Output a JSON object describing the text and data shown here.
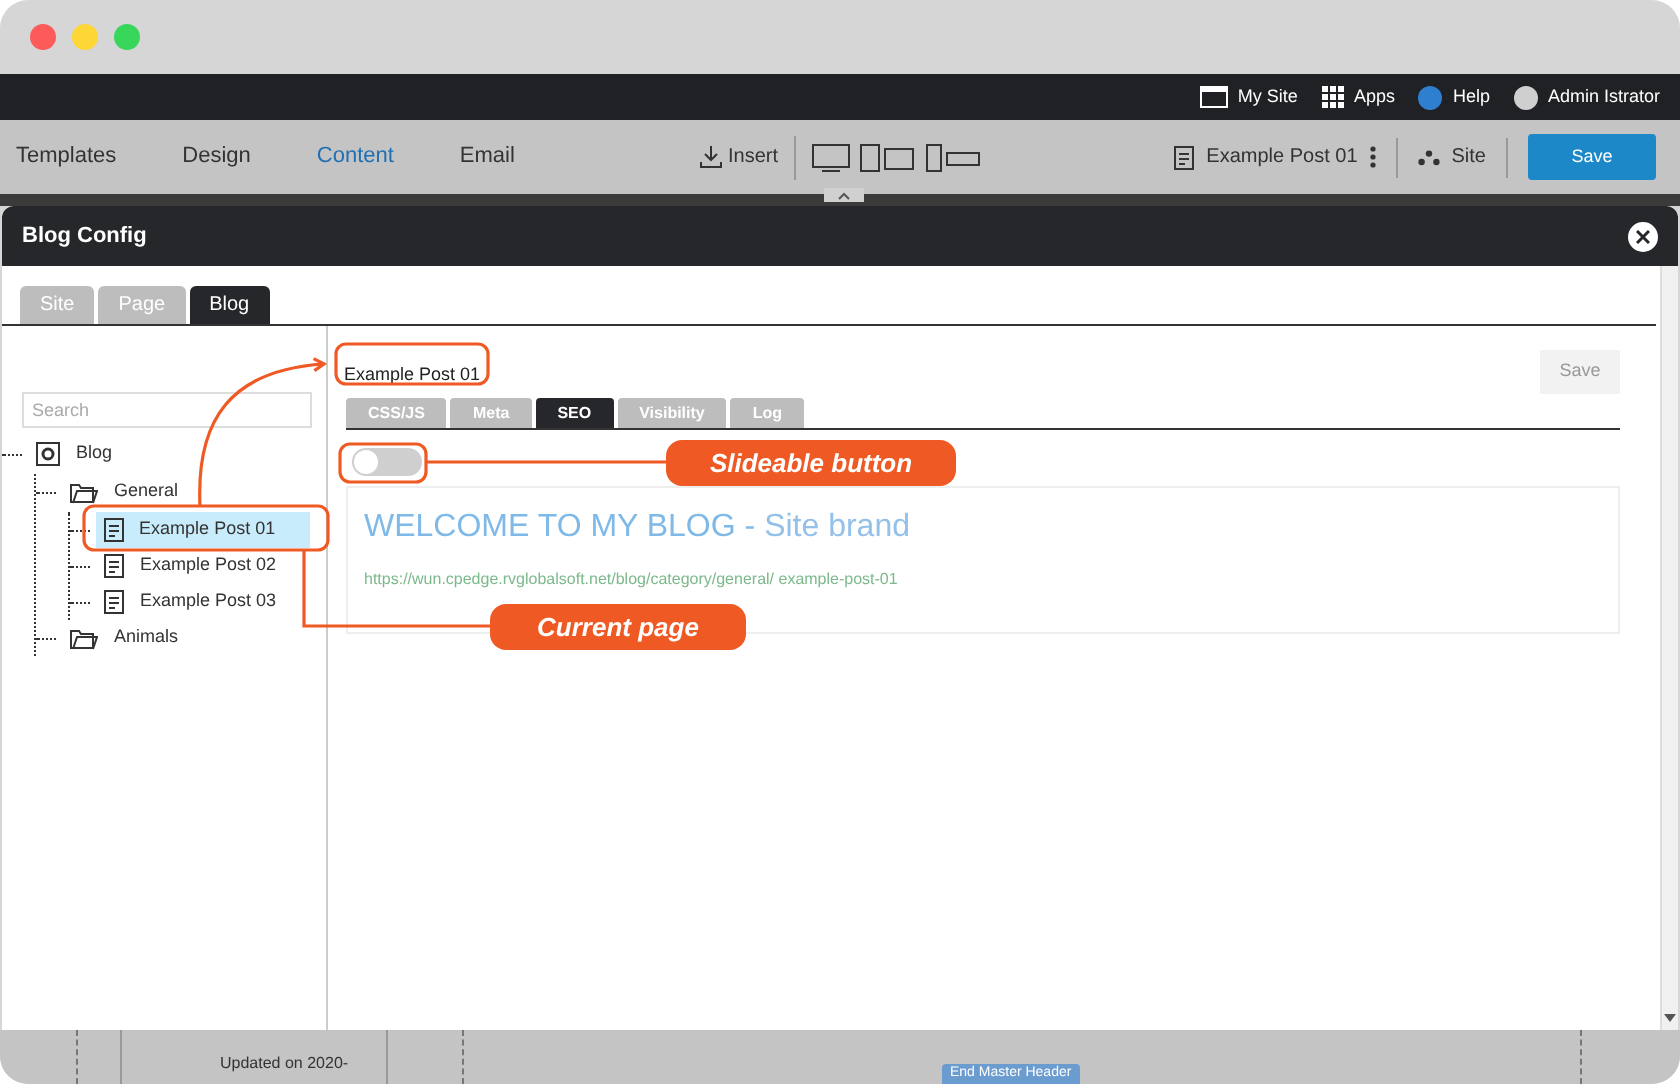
{
  "top_bar": {
    "items": [
      {
        "kind": "site",
        "label": "My Site"
      },
      {
        "kind": "apps",
        "label": "Apps"
      },
      {
        "kind": "help",
        "label": "Help"
      },
      {
        "kind": "user",
        "label": "Admin Istrator"
      }
    ]
  },
  "toolbar": {
    "tabs": [
      {
        "label": "Templates",
        "selected": false
      },
      {
        "label": "Design",
        "selected": false
      },
      {
        "label": "Content",
        "selected": true
      },
      {
        "label": "Email",
        "selected": false
      }
    ],
    "insert": "Insert",
    "page": "Example Post 01",
    "site": "Site",
    "save": "Save"
  },
  "dialog": {
    "title": "Blog Config",
    "tabs": [
      {
        "label": "Site",
        "selected": false
      },
      {
        "label": "Page",
        "selected": false
      },
      {
        "label": "Blog",
        "selected": true
      }
    ],
    "search": {
      "placeholder": "Search"
    },
    "tree": [
      {
        "kind": "site",
        "label": "Blog",
        "selected": false,
        "children": [
          {
            "kind": "folder",
            "label": "General",
            "selected": false,
            "children": [
              {
                "kind": "page",
                "label": "Example Post 01",
                "selected": true
              },
              {
                "kind": "page",
                "label": "Example Post 02",
                "selected": false
              },
              {
                "kind": "page",
                "label": "Example Post 03",
                "selected": false
              }
            ]
          },
          {
            "kind": "folder",
            "label": "Animals",
            "selected": false
          }
        ]
      }
    ],
    "editor": {
      "title": "Example Post 01",
      "save": "Save",
      "tabs": [
        {
          "label": "CSS/JS",
          "selected": false
        },
        {
          "label": "Meta",
          "selected": false
        },
        {
          "label": "SEO",
          "selected": true
        },
        {
          "label": "Visibility",
          "selected": false
        },
        {
          "label": "Log",
          "selected": false
        }
      ],
      "toggle": {
        "on": false
      },
      "preview": {
        "heading": "WELCOME TO MY BLOG",
        "separator": "-",
        "brand": "Site brand",
        "url": "https://wun.cpedge.rvglobalsoft.net/blog/category/general/ example-post-01"
      }
    }
  },
  "annotations": [
    {
      "label": "Slideable button"
    },
    {
      "label": "Current page"
    }
  ],
  "background": {
    "updated": "Updated on 2020-",
    "badge": "End Master Header"
  }
}
